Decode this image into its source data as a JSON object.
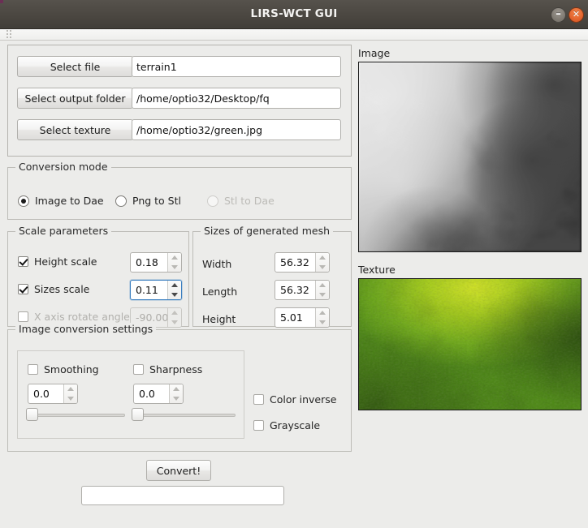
{
  "window": {
    "title": "LIRS-WCT GUI",
    "minimize_icon": "minimize-icon",
    "minimize_glyph": "–",
    "close_icon": "close-icon",
    "close_glyph": "✕",
    "titlebar_color": "#4b4741",
    "close_button_color": "#e2622c"
  },
  "files": {
    "select_file_button": "Select file",
    "select_file_value": "terrain1",
    "select_output_folder_button": "Select output folder",
    "select_output_folder_value": "/home/optio32/Desktop/fq",
    "select_texture_button": "Select texture",
    "select_texture_value": "/home/optio32/green.jpg"
  },
  "conversion_mode": {
    "title": "Conversion mode",
    "options": [
      {
        "label": "Image to Dae",
        "selected": true,
        "enabled": true
      },
      {
        "label": "Png to Stl",
        "selected": false,
        "enabled": true
      },
      {
        "label": "Stl to Dae",
        "selected": false,
        "enabled": false
      }
    ]
  },
  "scale_parameters": {
    "title": "Scale parameters",
    "rows": [
      {
        "label": "Height scale",
        "checked": true,
        "value": "0.18",
        "enabled": true,
        "focused": false
      },
      {
        "label": "Sizes scale",
        "checked": true,
        "value": "0.11",
        "enabled": true,
        "focused": true
      },
      {
        "label": "X axis rotate angle",
        "checked": false,
        "value": "-90.00",
        "enabled": false,
        "focused": false
      }
    ]
  },
  "mesh_sizes": {
    "title": "Sizes of generated mesh",
    "rows": [
      {
        "label": "Width",
        "value": "56.32"
      },
      {
        "label": "Length",
        "value": "56.32"
      },
      {
        "label": "Height",
        "value": "5.01"
      }
    ]
  },
  "image_conversion": {
    "title": "Image conversion settings",
    "smoothing": {
      "label": "Smoothing",
      "checked": false,
      "value": "0.0",
      "slider_percent": 0
    },
    "sharpness": {
      "label": "Sharpness",
      "checked": false,
      "value": "0.0",
      "slider_percent": 0
    },
    "color_inverse": {
      "label": "Color inverse",
      "checked": false
    },
    "grayscale": {
      "label": "Grayscale",
      "checked": false
    }
  },
  "previews": {
    "image_label": "Image",
    "texture_label": "Texture",
    "texture_base_color": "#6fae16",
    "texture_highlight_color": "#c3e01a"
  },
  "actions": {
    "convert_button": "Convert!",
    "status_value": "",
    "status_placeholder": ""
  }
}
